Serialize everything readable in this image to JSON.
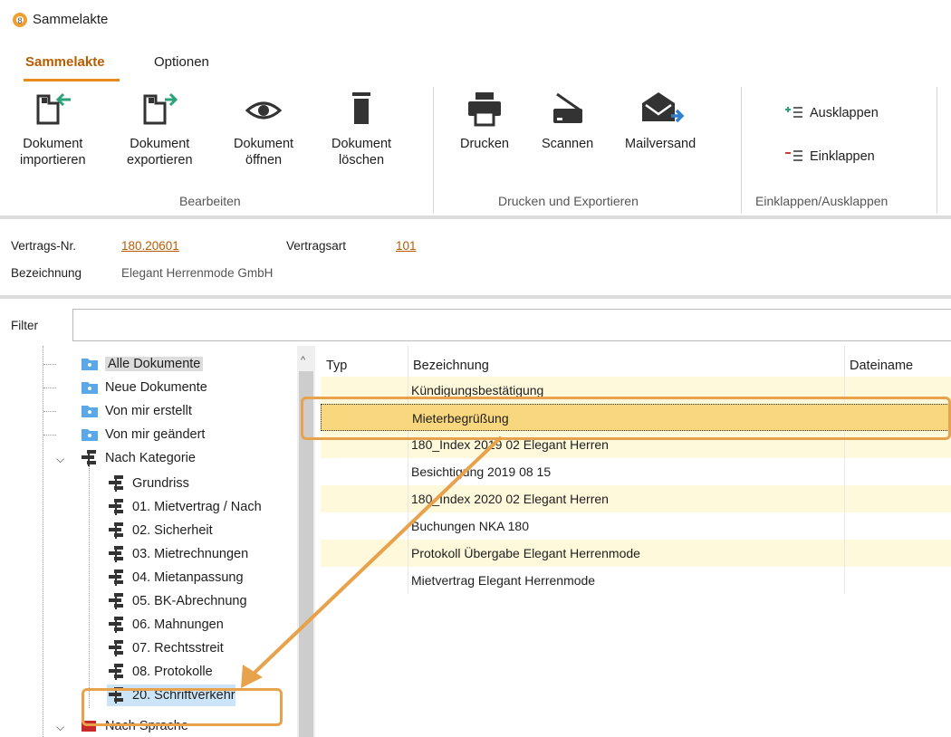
{
  "window": {
    "title": "Sammelakte"
  },
  "tabs": [
    {
      "label": "Sammelakte"
    },
    {
      "label": "Optionen"
    }
  ],
  "ribbon": {
    "bearbeiten": {
      "label": "Bearbeiten",
      "buttons": [
        {
          "line1": "Dokument",
          "line2": "importieren"
        },
        {
          "line1": "Dokument",
          "line2": "exportieren"
        },
        {
          "line1": "Dokument",
          "line2": "öffnen"
        },
        {
          "line1": "Dokument",
          "line2": "löschen"
        }
      ]
    },
    "drucken": {
      "label": "Drucken und Exportieren",
      "buttons": [
        {
          "line1": "Drucken"
        },
        {
          "line1": "Scannen"
        },
        {
          "line1": "Mailversand"
        }
      ]
    },
    "klappen": {
      "label": "Einklappen/Ausklappen",
      "buttons": [
        {
          "label": "Ausklappen"
        },
        {
          "label": "Einklappen"
        }
      ]
    }
  },
  "info": {
    "vertrags_nr_label": "Vertrags-Nr.",
    "vertrags_nr": "180.20601",
    "vertragsart_label": "Vertragsart",
    "vertragsart": "101",
    "bezeichnung_label": "Bezeichnung",
    "bezeichnung": "Elegant Herrenmode GmbH"
  },
  "filter": {
    "label": "Filter",
    "value": ""
  },
  "tree": {
    "items": [
      {
        "label": "Alle Dokumente"
      },
      {
        "label": "Neue Dokumente"
      },
      {
        "label": "Von mir erstellt"
      },
      {
        "label": "Von mir geändert"
      },
      {
        "label": "Nach Kategorie"
      },
      {
        "label": "Grundriss"
      },
      {
        "label": "01. Mietvertrag / Nach"
      },
      {
        "label": "02. Sicherheit"
      },
      {
        "label": "03. Mietrechnungen"
      },
      {
        "label": "04. Mietanpassung"
      },
      {
        "label": "05. BK-Abrechnung"
      },
      {
        "label": "06. Mahnungen"
      },
      {
        "label": "07. Rechtsstreit"
      },
      {
        "label": "08. Protokolle"
      },
      {
        "label": "20. Schriftverkehr"
      },
      {
        "label": "Nach Sprache"
      }
    ]
  },
  "list": {
    "headers": {
      "typ": "Typ",
      "bezeichnung": "Bezeichnung",
      "dateiname": "Dateiname"
    },
    "rows": [
      {
        "bezeichnung": "Kündigungsbestätigung"
      },
      {
        "bezeichnung": "Mieterbegrüßung"
      },
      {
        "bezeichnung": "180_Index 2019 02 Elegant Herren"
      },
      {
        "bezeichnung": "Besichtigung 2019 08 15"
      },
      {
        "bezeichnung": "180_Index 2020 02 Elegant Herren"
      },
      {
        "bezeichnung": "Buchungen NKA 180"
      },
      {
        "bezeichnung": "Protokoll Übergabe Elegant Herrenmode"
      },
      {
        "bezeichnung": "Mietvertrag Elegant Herrenmode"
      }
    ]
  },
  "colors": {
    "accent": "#b85c00",
    "highlight": "#e7a24b",
    "selected_row": "#f9d77e",
    "alt_row": "#fff9dc"
  }
}
